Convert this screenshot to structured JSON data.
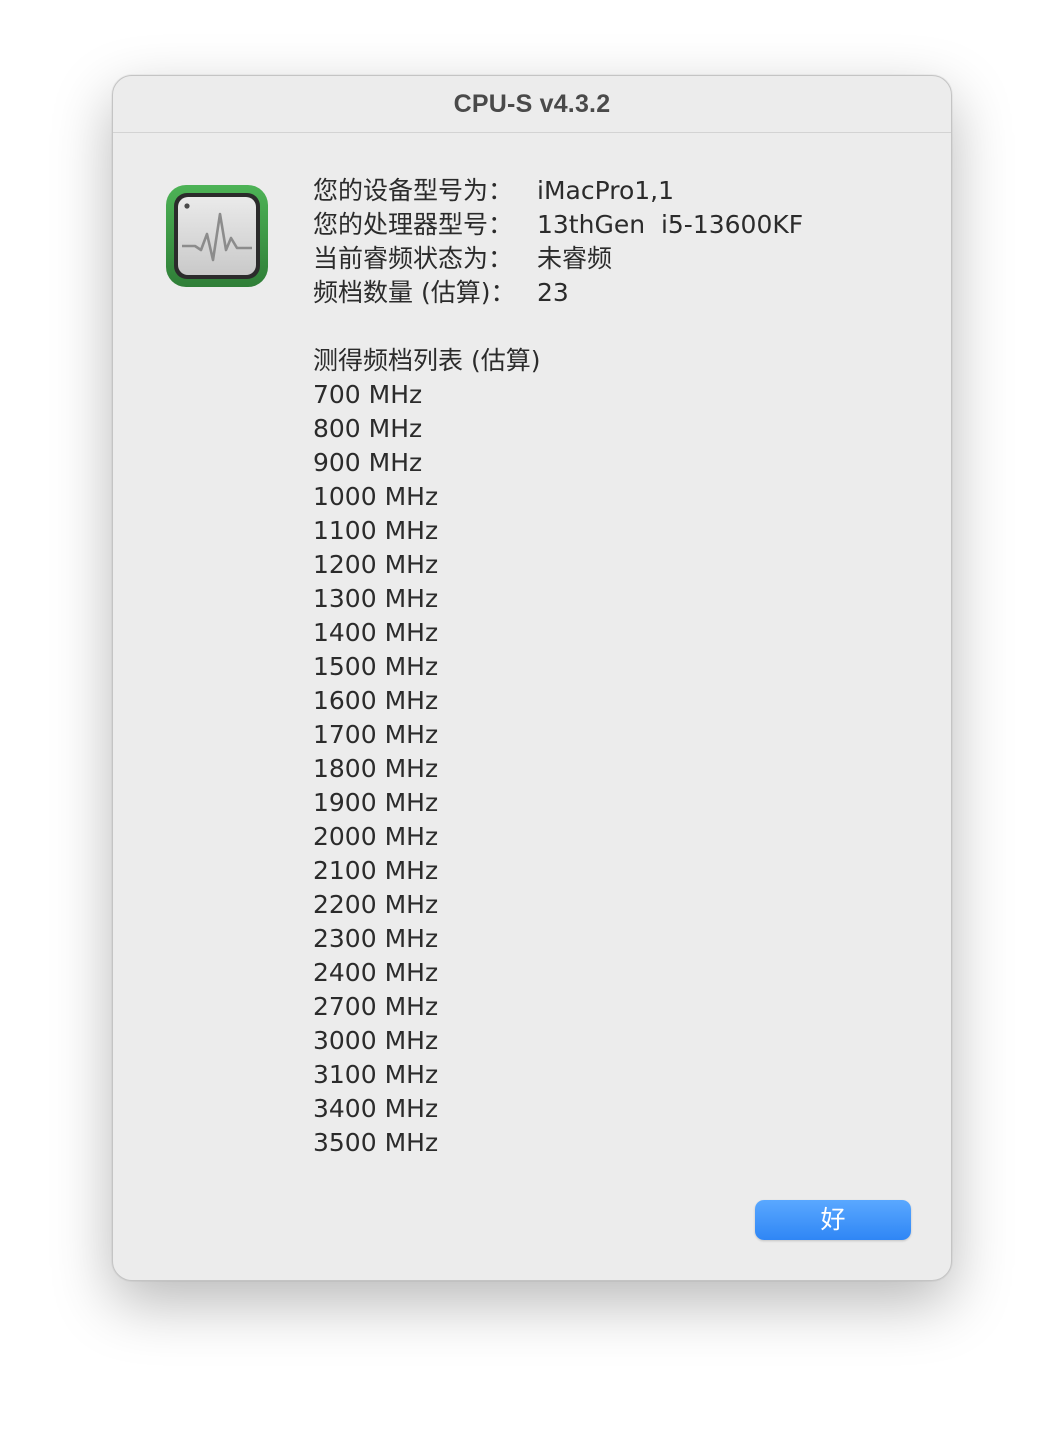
{
  "window": {
    "title": "CPU-S v4.3.2"
  },
  "icon": {
    "name": "activity-monitor-icon",
    "accent": "#3d9b47"
  },
  "info": [
    {
      "label": "您的设备型号为：",
      "value": "iMacPro1,1"
    },
    {
      "label": "您的处理器型号：",
      "value": "13thGen  i5-13600KF"
    },
    {
      "label": "当前睿频状态为：",
      "value": "未睿频"
    },
    {
      "label": "频档数量 (估算)：",
      "value": "23"
    }
  ],
  "freq_list": {
    "heading": "测得频档列表 (估算)",
    "items": [
      "700 MHz",
      "800 MHz",
      "900 MHz",
      "1000 MHz",
      "1100 MHz",
      "1200 MHz",
      "1300 MHz",
      "1400 MHz",
      "1500 MHz",
      "1600 MHz",
      "1700 MHz",
      "1800 MHz",
      "1900 MHz",
      "2000 MHz",
      "2100 MHz",
      "2200 MHz",
      "2300 MHz",
      "2400 MHz",
      "2700 MHz",
      "3000 MHz",
      "3100 MHz",
      "3400 MHz",
      "3500 MHz"
    ]
  },
  "buttons": {
    "ok_label": "好",
    "ok_color": "#3a8ef6"
  }
}
